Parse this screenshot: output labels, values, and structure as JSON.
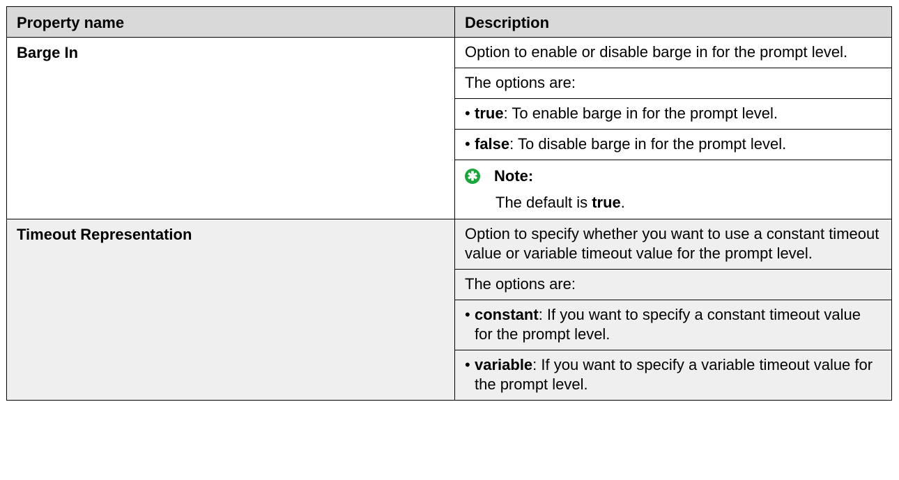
{
  "table": {
    "headers": {
      "property": "Property name",
      "description": "Description"
    },
    "rows": [
      {
        "name": "Barge In",
        "intro": "Option to enable or disable barge in for the prompt level.",
        "options_label": "The options are:",
        "options": [
          {
            "term": "true",
            "text": ": To enable barge in for the prompt level."
          },
          {
            "term": "false",
            "text": ": To disable barge in for the prompt level."
          }
        ],
        "note": {
          "label": "Note:",
          "text_prefix": "The default is ",
          "text_value": "true",
          "text_suffix": "."
        }
      },
      {
        "name": "Timeout Representation",
        "intro": "Option to specify whether you want to use a constant timeout value or variable timeout value for the prompt level.",
        "options_label": "The options are:",
        "options": [
          {
            "term": "constant",
            "text": ": If you want to specify a constant timeout value for the prompt level."
          },
          {
            "term": "variable",
            "text": ": If you want to specify a variable timeout value for the prompt level."
          }
        ]
      }
    ]
  },
  "bullet_char": "•",
  "note_icon_char": "✱"
}
